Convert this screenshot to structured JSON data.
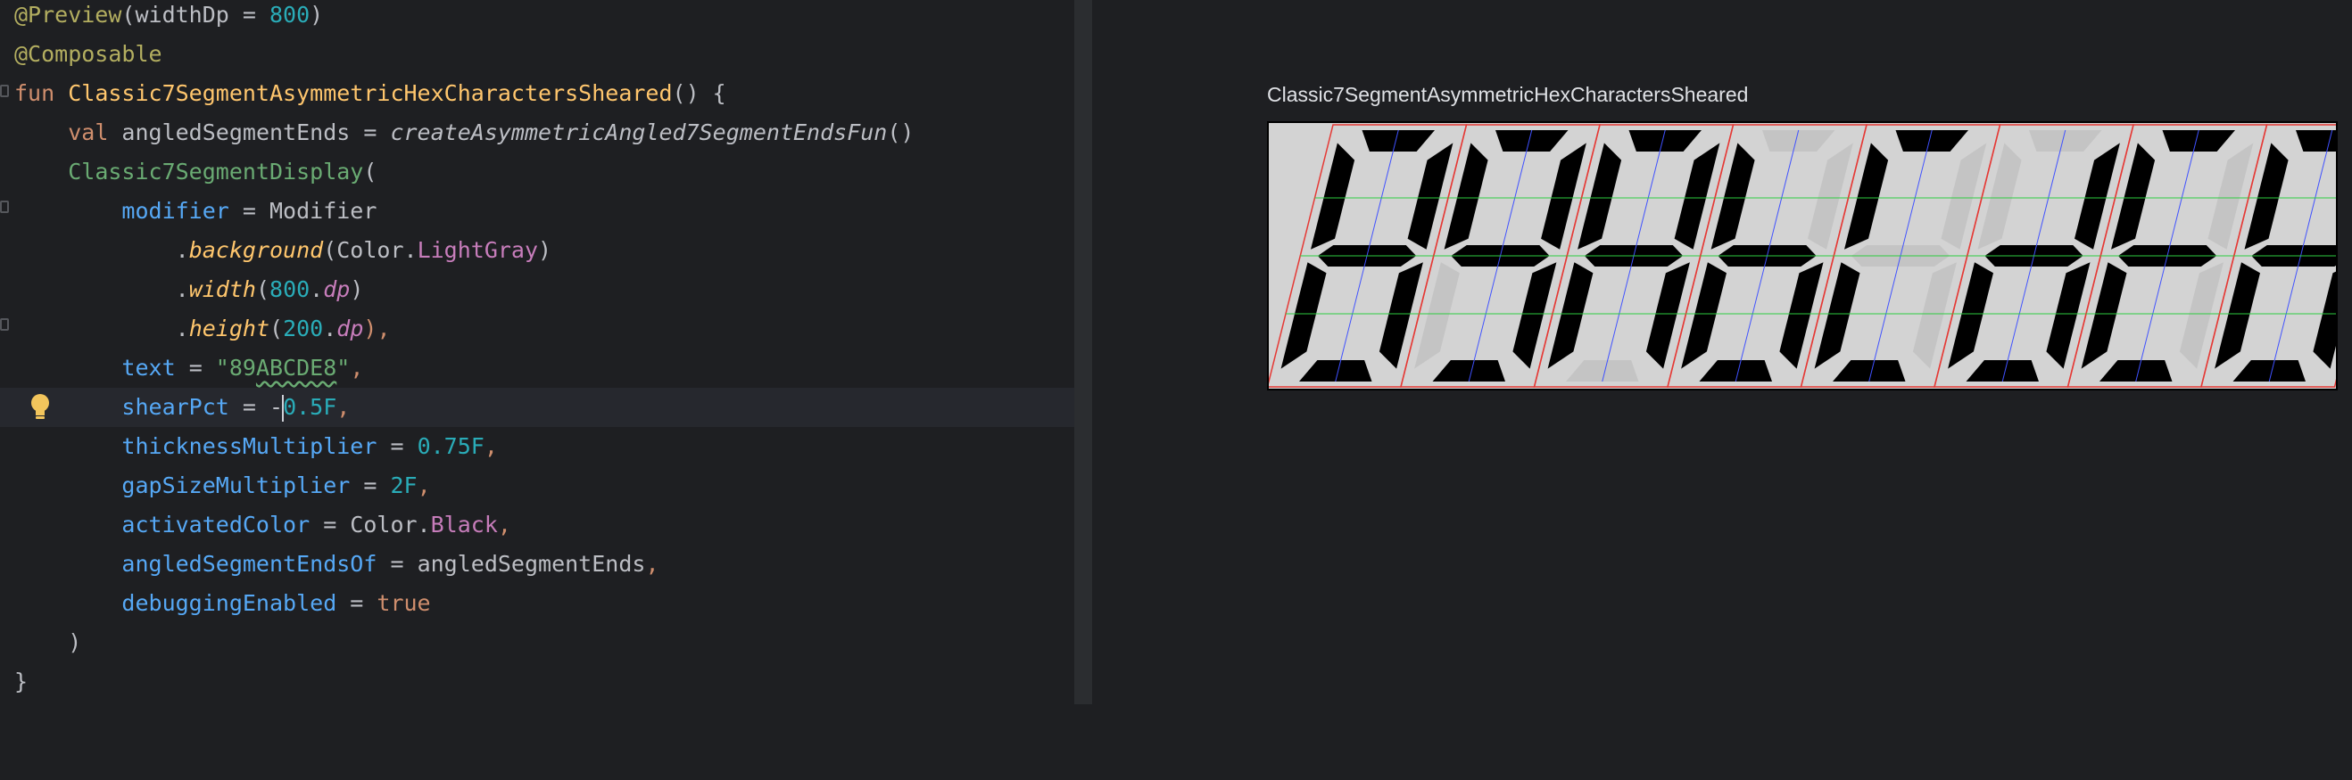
{
  "editor": {
    "lines": {
      "l1": {
        "ann": "@Preview",
        "p1": "(widthDp = ",
        "num": "800",
        "p2": ")"
      },
      "l2": {
        "ann": "@Composable"
      },
      "l3": {
        "kw": "fun",
        "name": "Classic7SegmentAsymmetricHexCharactersSheared",
        "p": "() {"
      },
      "l4": {
        "kw": "val",
        "name": " angledSegmentEnds = ",
        "call": "createAsymmetricAngled7SegmentEndsFun",
        "p": "()"
      },
      "l5": {
        "call": "Classic7SegmentDisplay",
        "p": "("
      },
      "l6": {
        "param": "modifier",
        "eq": " = ",
        "val": "Modifier"
      },
      "l7": {
        "dot": ".",
        "fn": "background",
        "p1": "(Color.",
        "prop": "LightGray",
        "p2": ")"
      },
      "l8": {
        "dot": ".",
        "fn": "width",
        "p1": "(",
        "num": "800",
        "dot2": ".",
        "prop": "dp",
        "p2": ")"
      },
      "l9": {
        "dot": ".",
        "fn": "height",
        "p1": "(",
        "num": "200",
        "dot2": ".",
        "prop": "dp",
        "p2": "),",
        "comma": ""
      },
      "l10": {
        "param": "text",
        "eq": " = ",
        "q1": "\"89",
        "typo": "ABCDE8",
        "q2": "\"",
        "comma": ","
      },
      "l11": {
        "param": "shearPct",
        "eq": " = ",
        "minus": "-",
        "rest": "0.5F",
        "comma": ","
      },
      "l12": {
        "param": "thicknessMultiplier",
        "eq": " = ",
        "num": "0.75F",
        "comma": ","
      },
      "l13": {
        "param": "gapSizeMultiplier",
        "eq": " = ",
        "num": "2F",
        "comma": ","
      },
      "l14": {
        "param": "activatedColor",
        "eq": " = ",
        "v1": "Color.",
        "prop": "Black",
        "comma": ","
      },
      "l15": {
        "param": "angledSegmentEndsOf",
        "eq": " = ",
        "v1": "angledSegmentEnds",
        "comma": ","
      },
      "l16": {
        "param": "debuggingEnabled",
        "eq": " = ",
        "kw": "true"
      },
      "l17": {
        "p": ")"
      },
      "l18": {
        "p": "}"
      }
    }
  },
  "preview": {
    "title": "Classic7SegmentAsymmetricHexCharactersSheared",
    "display_text": "89ABCDE8",
    "shear_pct": -0.5,
    "colors": {
      "background": "#d3d3d3",
      "activated": "#000000",
      "deactivated": "#c4c4c4",
      "debug_outline": "#e53935",
      "debug_vertical": "#3f51ff",
      "debug_horizontal": "#2ecc40"
    }
  }
}
